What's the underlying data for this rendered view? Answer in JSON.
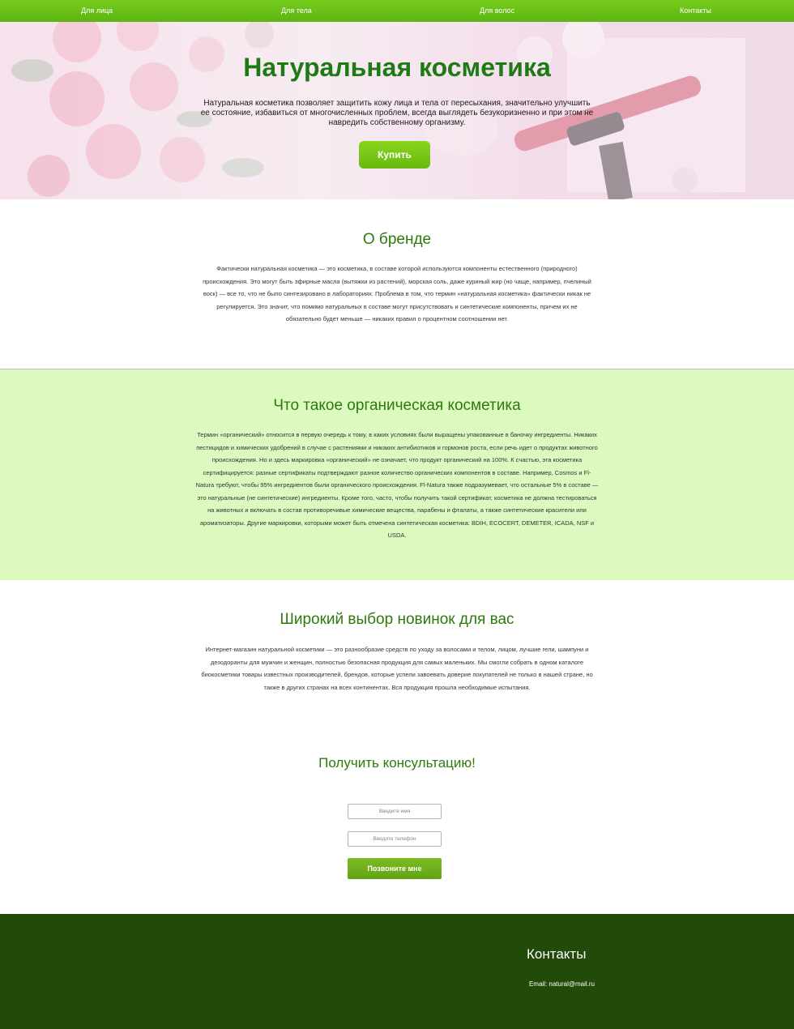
{
  "nav": {
    "items": [
      "Для лица",
      "Для тела",
      "Для волос",
      "Контакты"
    ]
  },
  "hero": {
    "title": "Натуральная косметика",
    "text": "Натуральная косметика позволяет защитить кожу лица и тела от пересыхания, значительно улучшить ее состояние, избавиться от многочисленных проблем, всегда выглядеть безукоризненно и при этом не навредить собственному организму.",
    "button": "Купить"
  },
  "about": {
    "title": "О бренде",
    "text": "Фактически натуральная косметика — это косметика, в составе которой используются компоненты естественного (природного) происхождения. Это могут быть эфирные масла (вытяжки из растений), морская соль, даже куриный жир (но чаще, например, пчелиный воск) — все то, что не было синтезировано в лабораториях. Проблема в том, что термин «натуральная косметика» фактически никак не регулируется. Это значит, что помимо натуральных в составе могут присутствовать и синтетические компоненты, причем их не обязательно будет меньше — никаких правил о процентном соотношении нет."
  },
  "organic": {
    "title": "Что такое органическая косметика",
    "text": "Термин «органический» относится в первую очередь к тому, в каких условиях были выращены упакованные в баночку ингредиенты. Никаких пестицидов и химических удобрений в случае с растениями и никаких антибиотиков и гормонов роста, если речь идет о продуктах животного происхождения. Но и здесь маркировка «органический» не означает, что продукт органический на 100%. К счастью, эта косметика сертифицируется: разные сертификаты подтверждают разное количество органических компонентов в составе. Например, Cosmos и Fl-Natura требуют, чтобы 95% ингредиентов были органического происхождения. Fl-Natura также подразумевает, что остальные 5% в составе — это натуральные (не синтетические) ингредиенты. Кроме того, часто, чтобы получить такой сертификат, косметика не должна тестироваться на животных и включать в состав противоречивые химические вещества, парабены и фталаты, а также синтетические красители или ароматизаторы. Другие маркировки, которыми может быть отмечена синтетическая косметика: BDIH, ECOCERT, DEMETER, ICADA, NSF и USDA."
  },
  "novelties": {
    "title": "Широкий выбор новинок для вас",
    "text": "Интернет-магазин натуральной косметики — это разнообразие средств по уходу за волосами и телом, лицом, лучшие гели, шампуни и дезодоранты для мужчин и женщин, полностью безопасная продукция для самых маленьких. Мы смогли собрать в одном каталоге биокосметики товары известных производителей, брендов, которые успели завоевать доверие покупателей не только в нашей стране, но также в других странах на всех континентах. Вся продукция прошла необходимые испытания."
  },
  "consult": {
    "title": "Получить консультацию!",
    "name_placeholder": "Введите имя",
    "phone_placeholder": "Введите телефон",
    "button": "Позвоните мне"
  },
  "footer": {
    "title": "Контакты",
    "email": "Email: natural@mail.ru"
  },
  "colors": {
    "nav": "#66c116",
    "accent_green": "#2d7a0c",
    "organic_bg": "#dcfabf",
    "footer_bg": "#224a08"
  }
}
